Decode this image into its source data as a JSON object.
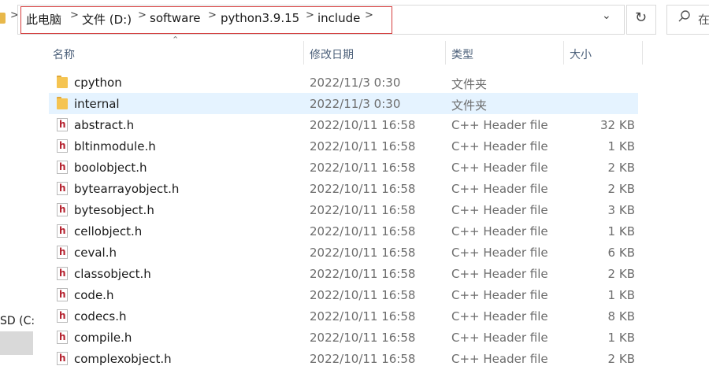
{
  "address_bar": {
    "crumbs": [
      "此电脑",
      "文件 (D:)",
      "software",
      "python3.9.15",
      "include"
    ],
    "separator": ">",
    "dropdown_icon": "chevron-down-icon",
    "refresh_icon": "refresh-icon",
    "search_placeholder": "在"
  },
  "nav": {
    "drive_label": "SD (C:"
  },
  "columns": {
    "name": "名称",
    "date": "修改日期",
    "type": "类型",
    "size": "大小"
  },
  "files": [
    {
      "name": "cpython",
      "date": "2022/11/3 0:30",
      "type": "文件夹",
      "size": "",
      "kind": "folder",
      "selected": false
    },
    {
      "name": "internal",
      "date": "2022/11/3 0:30",
      "type": "文件夹",
      "size": "",
      "kind": "folder",
      "selected": true
    },
    {
      "name": "abstract.h",
      "date": "2022/10/11 16:58",
      "type": "C++ Header file",
      "size": "32 KB",
      "kind": "header",
      "selected": false
    },
    {
      "name": "bltinmodule.h",
      "date": "2022/10/11 16:58",
      "type": "C++ Header file",
      "size": "1 KB",
      "kind": "header",
      "selected": false
    },
    {
      "name": "boolobject.h",
      "date": "2022/10/11 16:58",
      "type": "C++ Header file",
      "size": "2 KB",
      "kind": "header",
      "selected": false
    },
    {
      "name": "bytearrayobject.h",
      "date": "2022/10/11 16:58",
      "type": "C++ Header file",
      "size": "2 KB",
      "kind": "header",
      "selected": false
    },
    {
      "name": "bytesobject.h",
      "date": "2022/10/11 16:58",
      "type": "C++ Header file",
      "size": "3 KB",
      "kind": "header",
      "selected": false
    },
    {
      "name": "cellobject.h",
      "date": "2022/10/11 16:58",
      "type": "C++ Header file",
      "size": "1 KB",
      "kind": "header",
      "selected": false
    },
    {
      "name": "ceval.h",
      "date": "2022/10/11 16:58",
      "type": "C++ Header file",
      "size": "6 KB",
      "kind": "header",
      "selected": false
    },
    {
      "name": "classobject.h",
      "date": "2022/10/11 16:58",
      "type": "C++ Header file",
      "size": "2 KB",
      "kind": "header",
      "selected": false
    },
    {
      "name": "code.h",
      "date": "2022/10/11 16:58",
      "type": "C++ Header file",
      "size": "1 KB",
      "kind": "header",
      "selected": false
    },
    {
      "name": "codecs.h",
      "date": "2022/10/11 16:58",
      "type": "C++ Header file",
      "size": "8 KB",
      "kind": "header",
      "selected": false
    },
    {
      "name": "compile.h",
      "date": "2022/10/11 16:58",
      "type": "C++ Header file",
      "size": "1 KB",
      "kind": "header",
      "selected": false
    },
    {
      "name": "complexobject.h",
      "date": "2022/10/11 16:58",
      "type": "C++ Header file",
      "size": "2 KB",
      "kind": "header",
      "selected": false
    }
  ],
  "colors": {
    "highlight_border": "#d43c3c",
    "selected_row": "#e5f3ff",
    "header_icon": "#b5222f",
    "folder": "#f5c451"
  }
}
